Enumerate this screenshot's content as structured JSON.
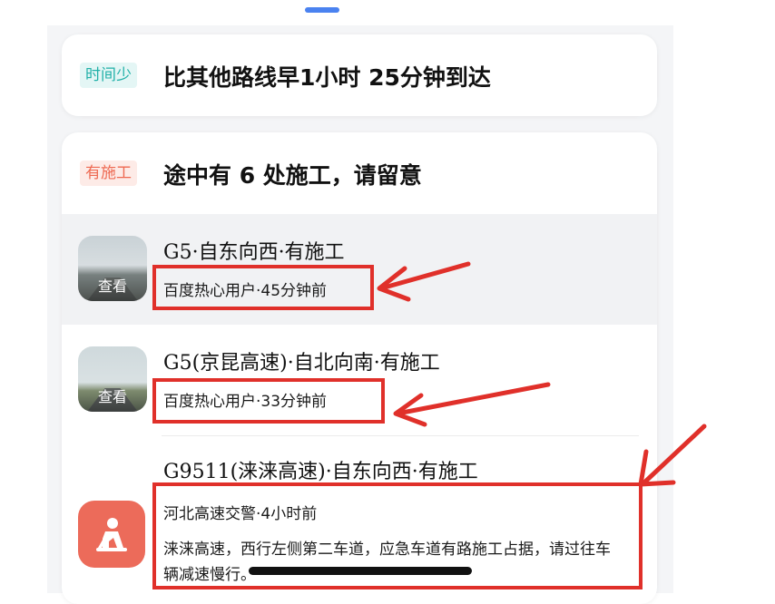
{
  "summary_time": {
    "tag": "时间少",
    "headline": "比其他路线早1小时 25分钟到达"
  },
  "summary_construction": {
    "tag": "有施工",
    "headline": "途中有 6 处施工，请留意"
  },
  "items": [
    {
      "title": "G5·自东向西·有施工",
      "source": "百度热心用户·45分钟前",
      "thumb_label": "查看"
    },
    {
      "title": "G5(京昆高速)·自北向南·有施工",
      "source": "百度热心用户·33分钟前",
      "thumb_label": "查看"
    },
    {
      "title": "G9511(涞涞高速)·自东向西·有施工",
      "source": "河北高速交警·4小时前",
      "description": "涞涞高速，西行左侧第二车道，应急车道有路施工占据，请过往车辆减速慢行。",
      "icon": "construction-worker-icon"
    }
  ],
  "colors": {
    "time_tag": "#21b0a8",
    "construction_tag": "#ee6a52",
    "highlight": "#e0302a",
    "handle": "#4a82f0"
  }
}
